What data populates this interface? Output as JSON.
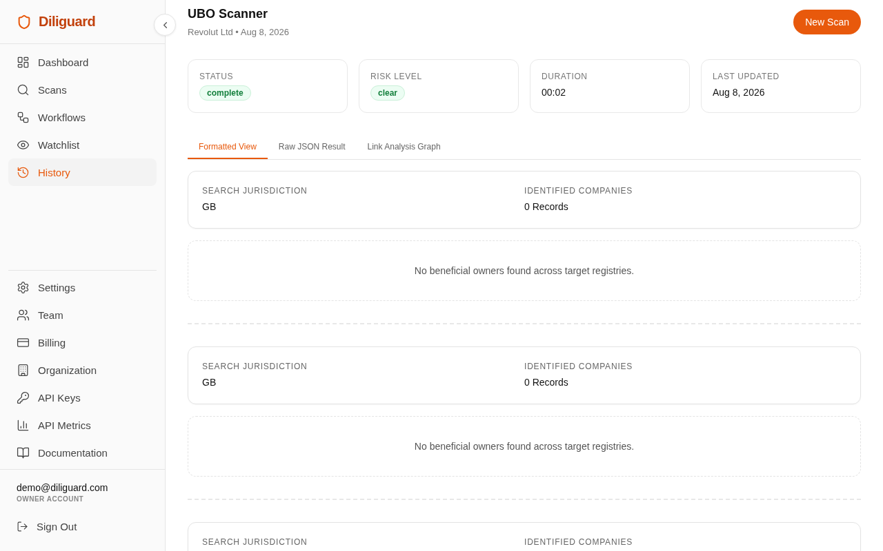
{
  "sidebar": {
    "brand": "Diliguard",
    "nav_items": [
      {
        "label": "Dashboard",
        "selected": false
      },
      {
        "label": "Scans",
        "selected": false
      },
      {
        "label": "Workflows",
        "selected": false
      },
      {
        "label": "Watchlist",
        "selected": false
      },
      {
        "label": "History",
        "selected": true
      }
    ],
    "settings_items": [
      {
        "label": "Settings",
        "selected": false
      },
      {
        "label": "Team",
        "selected": false
      },
      {
        "label": "Billing",
        "selected": false
      },
      {
        "label": "Organization",
        "selected": false
      },
      {
        "label": "API Keys",
        "selected": false
      },
      {
        "label": "API Metrics",
        "selected": false
      },
      {
        "label": "Documentation",
        "selected": false
      }
    ],
    "user": {
      "email": "demo@diliguard.com",
      "role": "OWNER ACCOUNT"
    },
    "sign_out": "Sign Out"
  },
  "header": {
    "title": "UBO Scanner",
    "subtitle": "Revolut Ltd • Aug 8, 2026",
    "button": "New Scan"
  },
  "stats": [
    {
      "label": "STATUS",
      "value": "complete",
      "kind": "badge"
    },
    {
      "label": "RISK LEVEL",
      "value": "clear",
      "kind": "badge"
    },
    {
      "label": "DURATION",
      "value": "00:02",
      "kind": "text"
    },
    {
      "label": "LAST UPDATED",
      "value": "Aug 8, 2026",
      "kind": "text"
    }
  ],
  "tabs": [
    {
      "label": "Formatted View",
      "selected": true
    },
    {
      "label": "Raw JSON Result",
      "selected": false
    },
    {
      "label": "Link Analysis Graph",
      "selected": false
    }
  ],
  "results": [
    {
      "fields": [
        {
          "label": "SEARCH JURISDICTION",
          "value": "GB"
        },
        {
          "label": "IDENTIFIED COMPANIES",
          "value": "0 Records"
        }
      ],
      "empty_message": "No beneficial owners found across target registries."
    },
    {
      "fields": [
        {
          "label": "SEARCH JURISDICTION",
          "value": "GB"
        },
        {
          "label": "IDENTIFIED COMPANIES",
          "value": "0 Records"
        }
      ],
      "empty_message": "No beneficial owners found across target registries."
    },
    {
      "fields": [
        {
          "label": "SEARCH JURISDICTION"
        },
        {
          "label": "IDENTIFIED COMPANIES"
        }
      ]
    }
  ]
}
